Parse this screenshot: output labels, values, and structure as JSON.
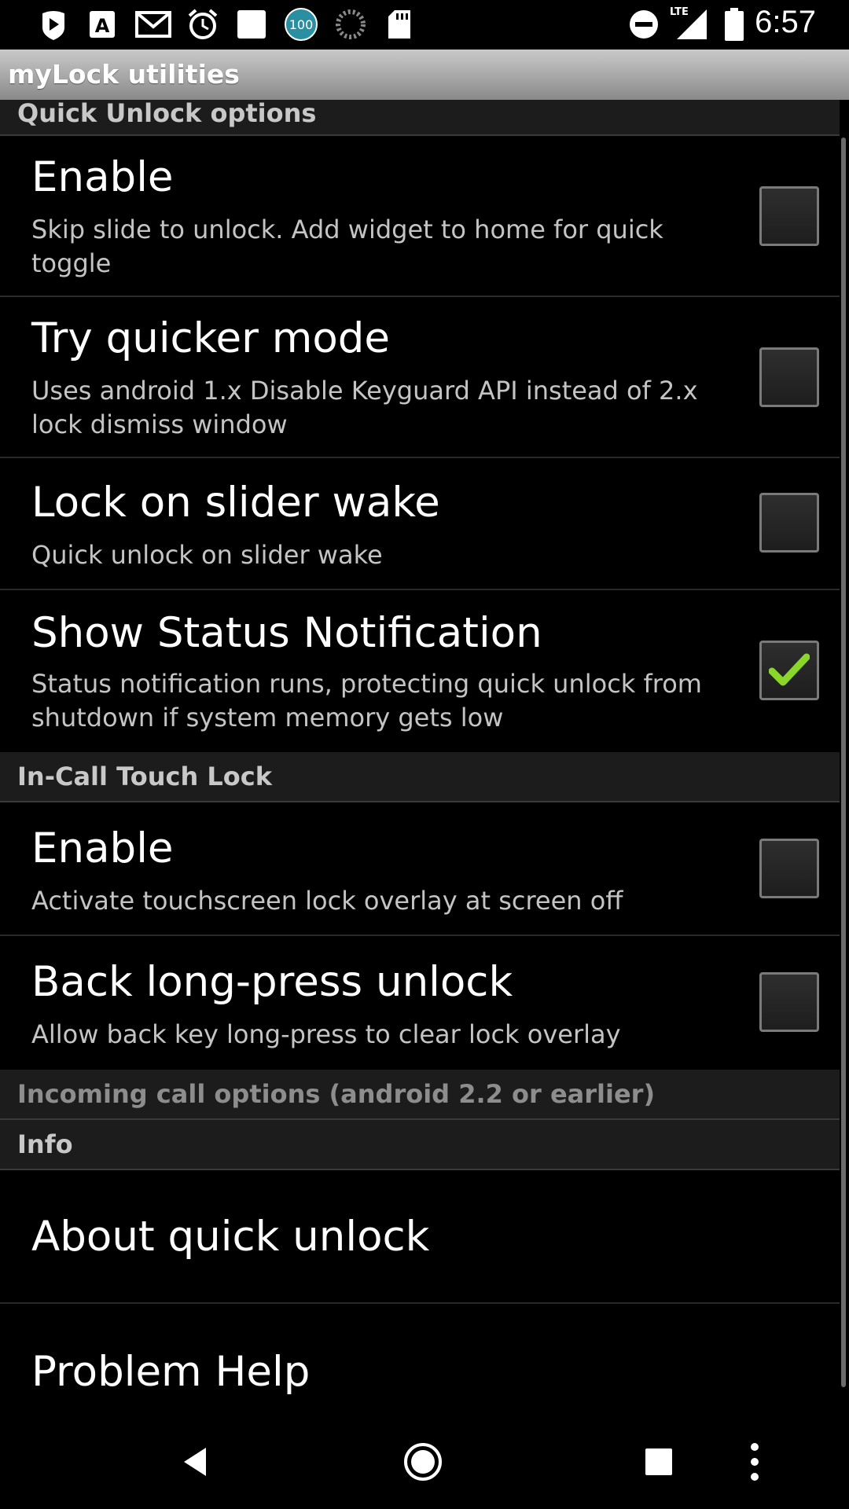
{
  "status_bar": {
    "time": "6:57",
    "battery_badge": "100",
    "network_label": "LTE",
    "icons": [
      "play-store-icon",
      "font-a-icon",
      "gmail-icon",
      "alarm-icon",
      "square-app-icon",
      "battery-100-badge-icon",
      "loading-circle-icon",
      "sd-card-icon",
      "do-not-disturb-icon",
      "signal-lte-icon",
      "battery-icon"
    ]
  },
  "app": {
    "title": "myLock utilities"
  },
  "sections": [
    {
      "header": "Quick Unlock options",
      "items": [
        {
          "title": "Enable",
          "summary": "Skip slide to unlock. Add widget to home for quick toggle",
          "checked": false
        },
        {
          "title": "Try quicker mode",
          "summary": "Uses android 1.x Disable Keyguard API instead of 2.x lock dismiss window",
          "checked": false
        },
        {
          "title": "Lock on slider wake",
          "summary": "Quick unlock on slider wake",
          "checked": false
        },
        {
          "title": "Show Status Notification",
          "summary": "Status notification runs, protecting quick unlock from shutdown if system memory gets low",
          "checked": true
        }
      ]
    },
    {
      "header": "In-Call Touch Lock",
      "items": [
        {
          "title": "Enable",
          "summary": "Activate touchscreen lock overlay at screen off",
          "checked": false
        },
        {
          "title": "Back long-press unlock",
          "summary": "Allow back key long-press to clear lock overlay",
          "checked": false
        }
      ]
    },
    {
      "header": "Incoming call options (android 2.2 or earlier)",
      "items": []
    },
    {
      "header": "Info",
      "items": [
        {
          "title": "About quick unlock"
        },
        {
          "title": "Problem Help"
        }
      ]
    }
  ],
  "colors": {
    "check_green": "#8bd62a",
    "category_bg": "#1c1c1c",
    "titlebar_top": "#c9c9c9"
  },
  "nav_bar": {
    "icons": [
      "back-icon",
      "home-icon",
      "recents-icon",
      "overflow-menu-icon"
    ]
  }
}
